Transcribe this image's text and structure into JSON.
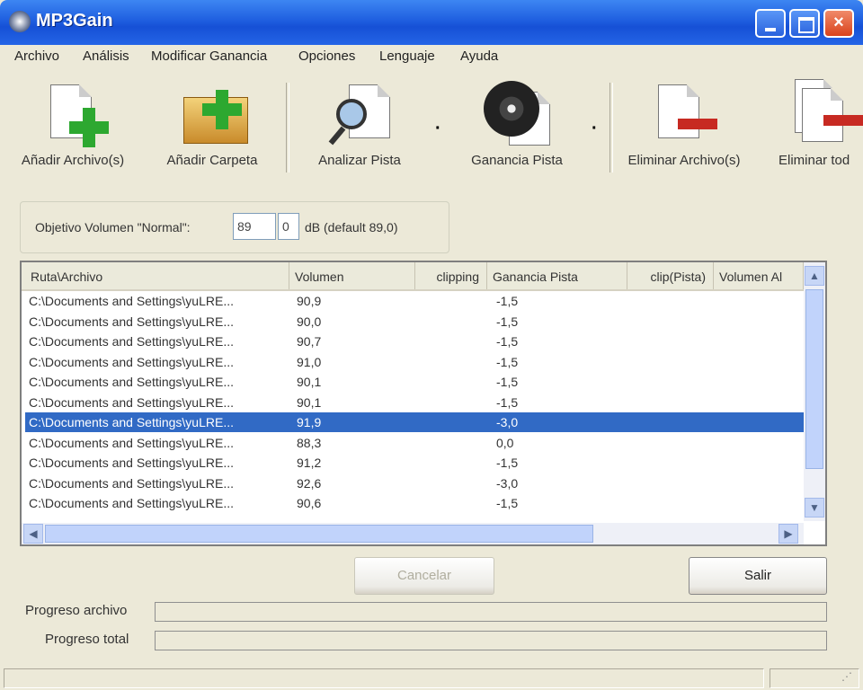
{
  "window": {
    "title": "MP3Gain",
    "controls": {
      "minimize": "minimize",
      "maximize": "maximize",
      "close": "×"
    }
  },
  "menu": [
    "Archivo",
    "Análisis",
    "Modificar Ganancia",
    "Opciones",
    "Lenguaje",
    "Ayuda"
  ],
  "toolbar": {
    "add_files": "Añadir Archivo(s)",
    "add_folder": "Añadir Carpeta",
    "analyze_track": "Analizar Pista",
    "track_gain": "Ganancia Pista",
    "remove_files": "Eliminar Archivo(s)",
    "remove_all": "Eliminar tod",
    "icon_add_files": "add-file-icon",
    "icon_add_folder": "add-folder-icon",
    "icon_analyze": "analyze-icon",
    "icon_gain": "cd-gain-icon",
    "icon_remove": "remove-file-icon",
    "icon_remove_all": "remove-all-icon"
  },
  "target": {
    "label": "Objetivo Volumen \"Normal\":",
    "integer": "89",
    "decimal": "0",
    "suffix": "dB  (default 89,0)"
  },
  "table": {
    "columns": [
      "Ruta\\Archivo",
      "Volumen",
      "clipping",
      "Ganancia Pista",
      "clip(Pista)",
      "Volumen Al"
    ],
    "rows": [
      {
        "path": "C:\\Documents and Settings\\yuLRE...",
        "volume": "90,9",
        "gain": "-1,5"
      },
      {
        "path": "C:\\Documents and Settings\\yuLRE...",
        "volume": "90,0",
        "gain": "-1,5"
      },
      {
        "path": "C:\\Documents and Settings\\yuLRE...",
        "volume": "90,7",
        "gain": "-1,5"
      },
      {
        "path": "C:\\Documents and Settings\\yuLRE...",
        "volume": "91,0",
        "gain": "-1,5"
      },
      {
        "path": "C:\\Documents and Settings\\yuLRE...",
        "volume": "90,1",
        "gain": "-1,5"
      },
      {
        "path": "C:\\Documents and Settings\\yuLRE...",
        "volume": "90,1",
        "gain": "-1,5"
      },
      {
        "path": "C:\\Documents and Settings\\yuLRE...",
        "volume": "91,9",
        "gain": "-3,0"
      },
      {
        "path": "C:\\Documents and Settings\\yuLRE...",
        "volume": "88,3",
        "gain": "0,0"
      },
      {
        "path": "C:\\Documents and Settings\\yuLRE...",
        "volume": "91,2",
        "gain": "-1,5"
      },
      {
        "path": "C:\\Documents and Settings\\yuLRE...",
        "volume": "92,6",
        "gain": "-3,0"
      },
      {
        "path": "C:\\Documents and Settings\\yuLRE...",
        "volume": "90,6",
        "gain": "-1,5"
      }
    ],
    "selected_index": 6
  },
  "buttons": {
    "cancel": "Cancelar",
    "exit": "Salir"
  },
  "progress": {
    "file_label": "Progreso archivo",
    "total_label": "Progreso total",
    "file_value": 0,
    "total_value": 0
  },
  "colors": {
    "titlebar": "#1f5fe0",
    "selection": "#316ac5",
    "window": "#ece9d8"
  }
}
